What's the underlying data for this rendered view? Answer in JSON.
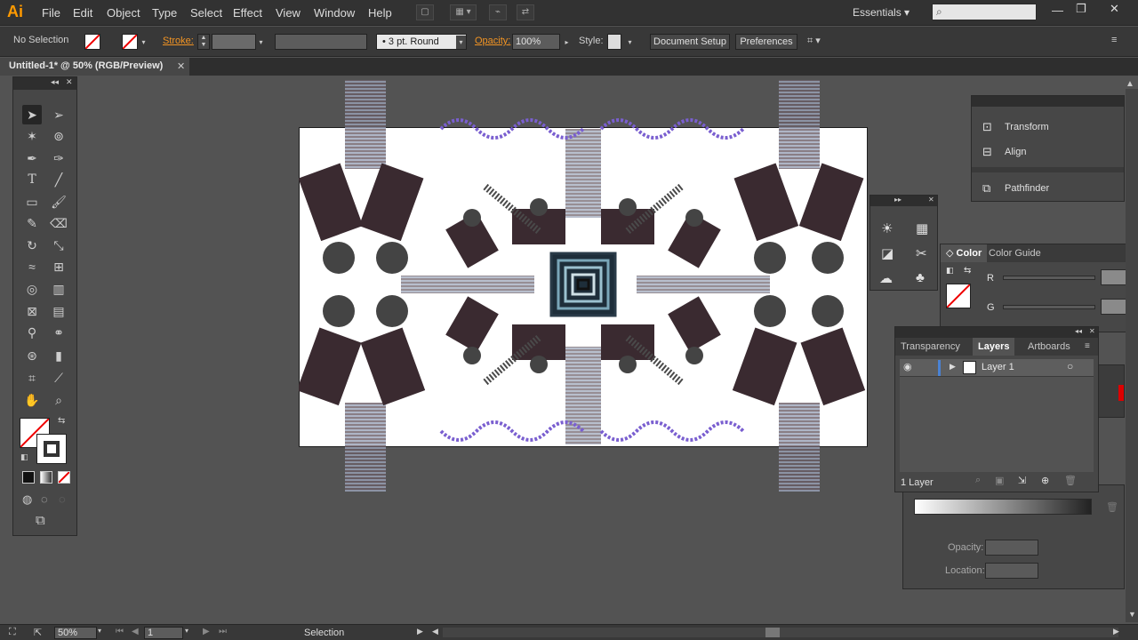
{
  "app": {
    "logo": "Ai"
  },
  "menu": [
    "File",
    "Edit",
    "Object",
    "Type",
    "Select",
    "Effect",
    "View",
    "Window",
    "Help"
  ],
  "workspace": "Essentials",
  "control_bar": {
    "selection": "No Selection",
    "stroke_label": "Stroke:",
    "brush": "3 pt. Round",
    "opacity_label": "Opacity:",
    "opacity_value": "100%",
    "style_label": "Style:",
    "document_setup": "Document Setup",
    "preferences": "Preferences"
  },
  "document_tab": "Untitled-1* @ 50% (RGB/Preview)",
  "panels": {
    "transform": "Transform",
    "align": "Align",
    "pathfinder": "Pathfinder",
    "color_tabs": [
      "Color",
      "Color Guide"
    ],
    "color_channels": [
      "R",
      "G"
    ],
    "layers_tabs": [
      "Transparency",
      "Layers",
      "Artboards"
    ],
    "layer_name": "Layer 1",
    "layer_count": "1 Layer",
    "gradient_opacity_label": "Opacity:",
    "gradient_location_label": "Location:"
  },
  "status": {
    "zoom": "50%",
    "artboard": "1",
    "tool": "Selection"
  },
  "colors": {
    "accent": "#ff9a00",
    "layer_highlight": "#4a82d4",
    "background": "#535353"
  }
}
